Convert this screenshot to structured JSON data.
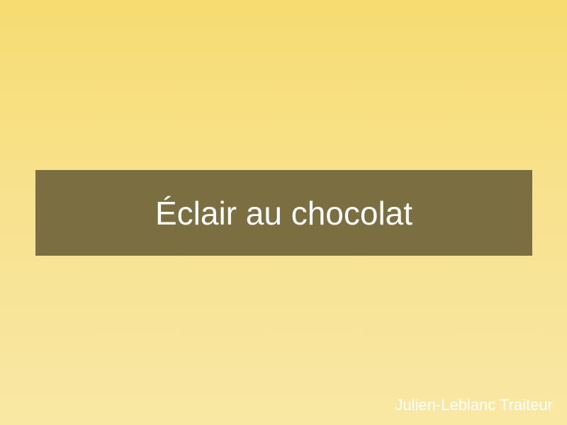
{
  "title": "Éclair au chocolat",
  "footer": "Julien-Leblanc Traiteur",
  "colors": {
    "background_top": "#f7dc72",
    "background_bottom": "#f9e8a4",
    "banner": "#7b6f42",
    "text": "#ffffff"
  }
}
